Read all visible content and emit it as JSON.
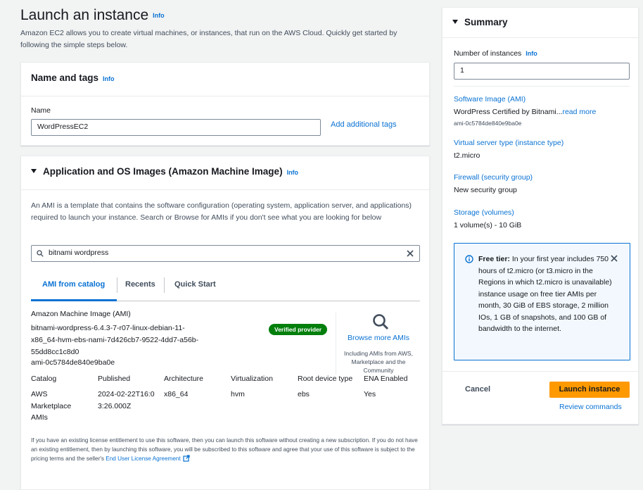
{
  "header": {
    "title": "Launch an instance",
    "info": "Info",
    "description": "Amazon EC2 allows you to create virtual machines, or instances, that run on the AWS Cloud. Quickly get started by following the simple steps below."
  },
  "name_tags": {
    "title": "Name and tags",
    "info": "Info",
    "name_label": "Name",
    "name_value": "WordPressEC2",
    "add_tags": "Add additional tags"
  },
  "ami": {
    "title": "Application and OS Images (Amazon Machine Image)",
    "info": "Info",
    "description": "An AMI is a template that contains the software configuration (operating system, application server, and applications) required to launch your instance. Search or Browse for AMIs if you don't see what you are looking for below",
    "search_value": "bitnami wordpress",
    "tabs": [
      "AMI from catalog",
      "Recents",
      "Quick Start"
    ],
    "block_label": "Amazon Machine Image (AMI)",
    "ami_name": "bitnami-wordpress-6.4.3-7-r07-linux-debian-11-x86_64-hvm-ebs-nami-7d426cb7-9522-4dd7-a56b-55dd8cc1c8d0",
    "ami_id": "ami-0c5784de840e9ba0e",
    "badge": "Verified provider",
    "browse_label": "Browse more AMIs",
    "browse_sub": "Including AMIs from AWS, Marketplace and the Community",
    "meta_headers": [
      "Catalog",
      "Published",
      "Architecture",
      "Virtualization",
      "Root device type",
      "ENA Enabled"
    ],
    "meta_values": [
      "AWS Marketplace AMIs",
      "2024-02-22T16:03:26.000Z",
      "x86_64",
      "hvm",
      "ebs",
      "Yes"
    ],
    "fineprint": "If you have an existing license entitlement to use this software, then you can launch this software without creating a new subscription. If you do not have an existing entitlement, then by launching this software, you will be subscribed to this software and agree that your use of this software is subject to the pricing terms and the seller's",
    "eula_link": "End User License Agreement"
  },
  "summary": {
    "title": "Summary",
    "num_label": "Number of instances",
    "info": "Info",
    "num_value": "1",
    "software_label": "Software Image (AMI)",
    "software_value": "WordPress Certified by Bitnami...",
    "read_more": "read more",
    "software_id": "ami-0c5784de840e9ba0e",
    "instance_type_label": "Virtual server type (instance type)",
    "instance_type_value": "t2.micro",
    "firewall_label": "Firewall (security group)",
    "firewall_value": "New security group",
    "storage_label": "Storage (volumes)",
    "storage_value": "1 volume(s) - 10 GiB",
    "free_tier_title": "Free tier:",
    "free_tier_text": "In your first year includes 750 hours of t2.micro (or t3.micro in the Regions in which t2.micro is unavailable) instance usage on free tier AMIs per month, 30 GiB of EBS storage, 2 million IOs, 1 GB of snapshots, and 100 GB of bandwidth to the internet.",
    "cancel": "Cancel",
    "launch": "Launch instance",
    "review": "Review commands"
  },
  "colors": {
    "accent": "#0972d3",
    "launch": "#ff9900",
    "badge": "#037f0c"
  }
}
